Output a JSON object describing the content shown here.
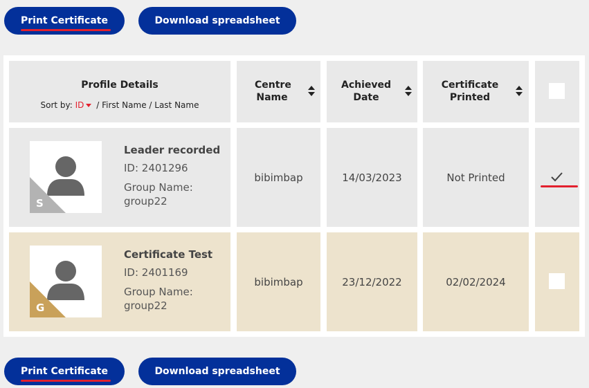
{
  "actions": {
    "print_label": "Print Certificate",
    "download_label": "Download spreadsheet"
  },
  "table": {
    "header": {
      "profile_title": "Profile Details",
      "sort_by_label": "Sort by:",
      "sort_id": "ID",
      "sort_first": "/ First Name",
      "sort_last": "/ Last Name",
      "centre_line1": "Centre",
      "centre_line2": "Name",
      "achieved_line1": "Achieved",
      "achieved_line2": "Date",
      "certificate_line1": "Certificate",
      "certificate_line2": "Printed"
    },
    "rows": [
      {
        "name": "Leader recorded",
        "id": "ID: 2401296",
        "group_label": "Group Name:",
        "group": "group22",
        "badge_letter": "S",
        "badge_color": "#b3b3b3",
        "row_color": "#e9e9e9",
        "centre": "bibimbap",
        "achieved": "14/03/2023",
        "certificate": "Not Printed",
        "checked": true
      },
      {
        "name": "Certificate Test",
        "id": "ID: 2401169",
        "group_label": "Group Name:",
        "group": "group22",
        "badge_letter": "G",
        "badge_color": "#c9a15a",
        "row_color": "#ede3cd",
        "centre": "bibimbap",
        "achieved": "23/12/2022",
        "certificate": "02/02/2024",
        "checked": false
      }
    ]
  },
  "colors": {
    "button_bg": "#03309a",
    "accent_red": "#e3202e",
    "page_bg": "#efefef"
  },
  "icons": {
    "avatar": "person-silhouette-icon",
    "check": "check-icon",
    "sort": "sort-arrows-icon",
    "caret": "caret-down-icon"
  }
}
